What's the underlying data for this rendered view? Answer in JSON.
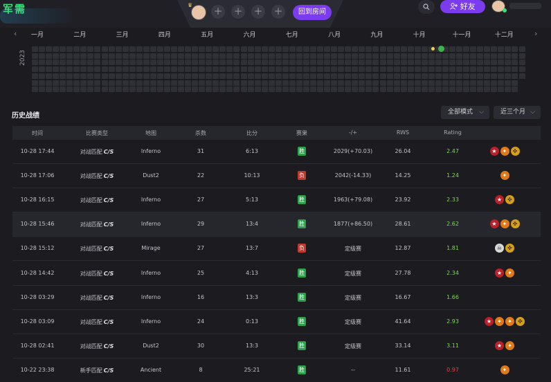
{
  "header": {
    "brand": "军需",
    "back_room_label": "回到房间",
    "friends_label": "好友",
    "search_icon": "search-icon",
    "friend_icon": "user-plus-icon",
    "plus_glyph": "+"
  },
  "calendar": {
    "year": "2023",
    "months": [
      "一月",
      "二月",
      "三月",
      "四月",
      "五月",
      "六月",
      "七月",
      "八月",
      "九月",
      "十月",
      "十一月",
      "十二月"
    ],
    "prev_glyph": "‹",
    "next_glyph": "›",
    "colors": {
      "empty": "#2f2f36",
      "minor": "#f2d04a",
      "major": "#3cb44b"
    }
  },
  "history": {
    "title": "历史战绩",
    "filter_mode": "全部模式",
    "filter_range": "近三个月",
    "chevron": "⌵",
    "columns": [
      "时间",
      "比赛类型",
      "地图",
      "杀数",
      "比分",
      "赛果",
      "-/+",
      "RWS",
      "Rating"
    ],
    "rows": [
      {
        "time": "10-28 17:44",
        "type": "对战匹配",
        "logo": "C/S",
        "map": "Inferno",
        "kills": "31",
        "score": "6:13",
        "result": "胜",
        "win": true,
        "elo": "2029(+70.03)",
        "rws": "26.04",
        "rating": "2.47",
        "rating_color": "#7ed957",
        "badges": [
          "red",
          "orange",
          "gold"
        ],
        "hl": false
      },
      {
        "time": "10-28 17:06",
        "type": "对战匹配",
        "logo": "C/S",
        "map": "Dust2",
        "kills": "22",
        "score": "10:13",
        "result": "负",
        "win": false,
        "elo": "2042(-14.33)",
        "rws": "14.25",
        "rating": "1.24",
        "rating_color": "#7ed957",
        "badges": [
          "orange"
        ],
        "hl": false
      },
      {
        "time": "10-28 16:15",
        "type": "对战匹配",
        "logo": "C/S",
        "map": "Inferno",
        "kills": "27",
        "score": "5:13",
        "result": "胜",
        "win": true,
        "elo": "1963(+79.08)",
        "rws": "23.92",
        "rating": "2.33",
        "rating_color": "#7ed957",
        "badges": [
          "red",
          "gold"
        ],
        "hl": false
      },
      {
        "time": "10-28 15:46",
        "type": "对战匹配",
        "logo": "C/S",
        "map": "Inferno",
        "kills": "29",
        "score": "13:4",
        "result": "胜",
        "win": true,
        "elo": "1877(+86.50)",
        "rws": "28.61",
        "rating": "2.62",
        "rating_color": "#7ed957",
        "badges": [
          "red",
          "orange",
          "gold"
        ],
        "hl": true
      },
      {
        "time": "10-28 15:12",
        "type": "对战匹配",
        "logo": "C/S",
        "map": "Mirage",
        "kills": "27",
        "score": "13:7",
        "result": "负",
        "win": false,
        "elo": "定级赛",
        "rws": "12.87",
        "rating": "1.81",
        "rating_color": "#7ed957",
        "badges": [
          "skull",
          "gold"
        ],
        "hl": false
      },
      {
        "time": "10-28 14:42",
        "type": "对战匹配",
        "logo": "C/S",
        "map": "Inferno",
        "kills": "25",
        "score": "4:13",
        "result": "胜",
        "win": true,
        "elo": "定级赛",
        "rws": "27.78",
        "rating": "2.34",
        "rating_color": "#7ed957",
        "badges": [
          "red",
          "orange"
        ],
        "hl": false
      },
      {
        "time": "10-28 03:29",
        "type": "对战匹配",
        "logo": "C/S",
        "map": "Inferno",
        "kills": "16",
        "score": "13:3",
        "result": "胜",
        "win": true,
        "elo": "定级赛",
        "rws": "16.67",
        "rating": "1.66",
        "rating_color": "#7ed957",
        "badges": [],
        "hl": false
      },
      {
        "time": "10-28 03:09",
        "type": "对战匹配",
        "logo": "C/S",
        "map": "Inferno",
        "kills": "24",
        "score": "0:13",
        "result": "胜",
        "win": true,
        "elo": "定级赛",
        "rws": "41.64",
        "rating": "2.93",
        "rating_color": "#7ed957",
        "badges": [
          "red",
          "orange",
          "orange",
          "gold"
        ],
        "hl": false
      },
      {
        "time": "10-28 02:41",
        "type": "对战匹配",
        "logo": "C/S",
        "map": "Dust2",
        "kills": "30",
        "score": "13:3",
        "result": "胜",
        "win": true,
        "elo": "定级赛",
        "rws": "33.14",
        "rating": "3.11",
        "rating_color": "#7ed957",
        "badges": [
          "red",
          "orange"
        ],
        "hl": false
      },
      {
        "time": "10-22 23:38",
        "type": "新手匹配",
        "logo": "C/S",
        "map": "Ancient",
        "kills": "8",
        "score": "25:21",
        "result": "胜",
        "win": true,
        "elo": "--",
        "rws": "11.61",
        "rating": "0.97",
        "rating_color": "#e04848",
        "badges": [
          "orange"
        ],
        "hl": false
      }
    ]
  }
}
